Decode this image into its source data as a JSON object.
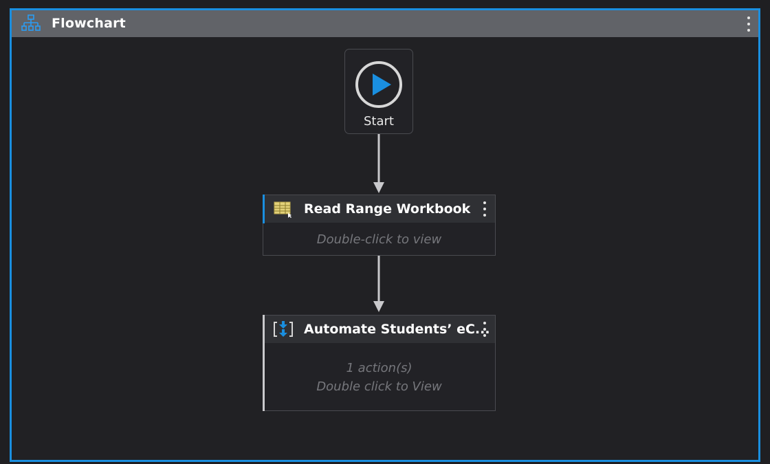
{
  "window": {
    "title": "Flowchart",
    "icon": "flowchart-icon",
    "accent_color": "#1a8fe0"
  },
  "start": {
    "label": "Start",
    "icon": "play-circle-icon"
  },
  "activities": [
    {
      "title": "Read Range Workbook",
      "icon": "excel-range-icon",
      "hint": "Double-click to view",
      "accent": "#1a8fe0"
    },
    {
      "title": "Automate Students’ eC...",
      "icon": "sequence-icon",
      "count_text": "1 action(s)",
      "hint": "Double click to View",
      "accent": "#c9c9cc"
    }
  ]
}
